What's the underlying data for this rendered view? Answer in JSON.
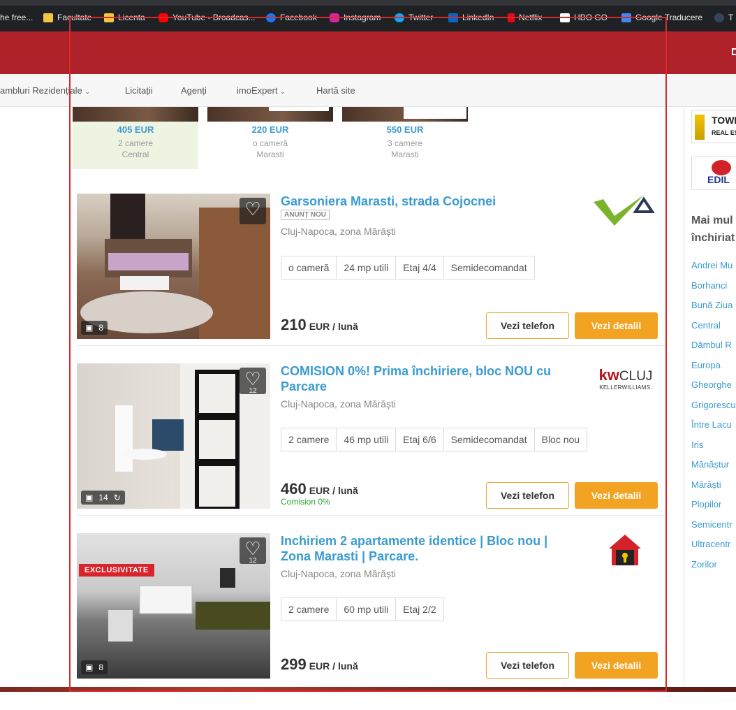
{
  "bookmarks": [
    {
      "label": "he free...",
      "color": "#777"
    },
    {
      "label": "Facultate",
      "color": "#f4c542"
    },
    {
      "label": "Licenta",
      "color": "#f4c542"
    },
    {
      "label": "YouTube - Broadcas...",
      "color": "#ff0000"
    },
    {
      "label": "Facebook",
      "color": "#1877f2"
    },
    {
      "label": "Instagram",
      "color": "#d6249f"
    },
    {
      "label": "Twitter",
      "color": "#1da1f2"
    },
    {
      "label": "LinkedIn",
      "color": "#0a66c2"
    },
    {
      "label": "Netflix",
      "color": "#e50914"
    },
    {
      "label": "HBO GO",
      "color": "#ffffff"
    },
    {
      "label": "Google Traducere",
      "color": "#4285f4"
    },
    {
      "label": "T",
      "color": "#35465c"
    }
  ],
  "nav": {
    "items": [
      "ambluri Rezidențiale",
      "Licitații",
      "Agenți",
      "imoExpert",
      "Hartă site"
    ]
  },
  "thumbs": [
    {
      "price": "405 EUR",
      "rooms": "2 camere",
      "zone": "Central"
    },
    {
      "price": "220 EUR",
      "rooms": "o cameră",
      "zone": "Marasti"
    },
    {
      "price": "550 EUR",
      "rooms": "3 camere",
      "zone": "Marasti"
    }
  ],
  "listings": [
    {
      "title": "Garsoniera Marasti, strada Cojocnei",
      "badge": "ANUNȚ NOU",
      "location": "Cluj-Napoca, zona Mărăști",
      "features": [
        "o cameră",
        "24 mp utili",
        "Etaj 4/4",
        "Semidecomandat"
      ],
      "price": "210",
      "unit": "EUR / lună",
      "photos": "8",
      "favorites": "",
      "phone_label": "Vezi telefon",
      "details_label": "Vezi detalii"
    },
    {
      "title": "COMISION 0%! Prima închiriere, bloc NOU cu Parcare",
      "location": "Cluj-Napoca, zona Mărăști",
      "features": [
        "2 camere",
        "46 mp utili",
        "Etaj 6/6",
        "Semidecomandat",
        "Bloc nou"
      ],
      "price": "460",
      "unit": "EUR / lună",
      "commission": "Comision 0%",
      "photos": "14",
      "favorites": "12",
      "agency": {
        "main": "kw",
        "city": "CLUJ",
        "sub": "KELLERWILLIAMS."
      },
      "phone_label": "Vezi telefon",
      "details_label": "Vezi detalii"
    },
    {
      "title": "Inchiriem 2 apartamente identice | Bloc nou | Zona Marasti | Parcare.",
      "location": "Cluj-Napoca, zona Mărăști",
      "features": [
        "2 camere",
        "60 mp utili",
        "Etaj 2/2"
      ],
      "price": "299",
      "unit": "EUR / lună",
      "photos": "8",
      "favorites": "12",
      "exclusive": "EXCLUSIVITATE",
      "phone_label": "Vezi telefon",
      "details_label": "Vezi detalii"
    }
  ],
  "sidebar": {
    "logos": [
      "TOWE",
      "REAL EST",
      "EDIL"
    ],
    "title_line1": "Mai mul",
    "title_line2": "închiriat",
    "zones": [
      "Andrei Mu",
      "Borhanci",
      "Bună Ziua",
      "Central",
      "Dâmbul R",
      "Europa",
      "Gheorghe",
      "Grigorescu",
      "Între Lacu",
      "Iris",
      "Mănăștur",
      "Mărăști",
      "Plopilor",
      "Semicentr",
      "Ultracentr",
      "Zorilor"
    ]
  }
}
